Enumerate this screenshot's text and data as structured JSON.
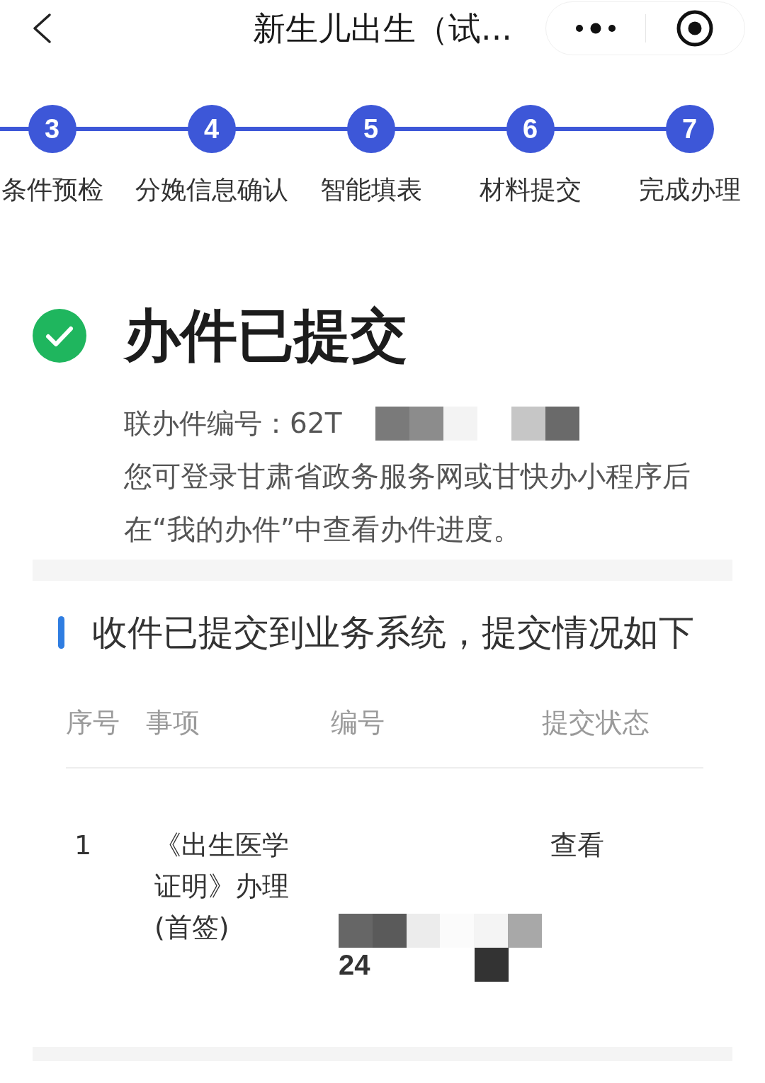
{
  "nav_bar": {
    "title": "新生儿出生（试..."
  },
  "steps": [
    {
      "number": "3",
      "label": "条件预检",
      "done": true
    },
    {
      "number": "4",
      "label": "分娩信息确认",
      "done": true
    },
    {
      "number": "5",
      "label": "智能填表",
      "done": true
    },
    {
      "number": "6",
      "label": "材料提交",
      "done": true
    },
    {
      "number": "7",
      "label": "完成办理",
      "done": true
    }
  ],
  "result": {
    "title": "办件已提交",
    "case_number": "联办件编号：62T",
    "note": "您可登录甘肃省政务服务网或甘快办小程序后在“我的办件”中查看办件进度。"
  },
  "section": {
    "title": "收件已提交到业务系统，提交情况如下"
  },
  "table": {
    "columns": [
      "序号",
      "事项",
      "编号",
      "提交状态"
    ],
    "rows": [
      {
        "index": "1",
        "item": "《出生医学证明》办理(首签)",
        "number": "24",
        "status": "查看"
      }
    ]
  }
}
